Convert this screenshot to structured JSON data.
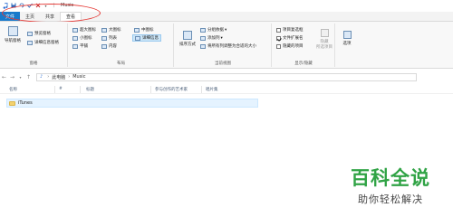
{
  "window": {
    "title": "Music"
  },
  "tabs": [
    {
      "label": "文件"
    },
    {
      "label": "主页"
    },
    {
      "label": "共享"
    },
    {
      "label": "查看"
    }
  ],
  "ribbon": {
    "panes": {
      "label": "窗格",
      "nav_pane": "导航窗格",
      "preview_pane": "预览窗格",
      "details_pane": "详细信息窗格"
    },
    "layout": {
      "label": "布局",
      "items": [
        "超大图标",
        "大图标",
        "中图标",
        "小图标",
        "列表",
        "详细信息",
        "平铺",
        "内容"
      ]
    },
    "current_view": {
      "label": "当前视图",
      "sort_by": "排序方式",
      "group_by": "分组依据",
      "add_columns": "添加列",
      "size_all_columns": "将所有列调整为合适的大小"
    },
    "show_hide": {
      "label": "显示/隐藏",
      "item_checkboxes": "项目复选框",
      "file_extensions": "文件扩展名",
      "hidden_items": "隐藏的项目",
      "hide_selected": "隐藏",
      "hide_selected_2": "所选项目"
    },
    "options": {
      "label": "选项"
    }
  },
  "address": {
    "crumbs": [
      "此电脑",
      "Music"
    ]
  },
  "columns": [
    "名称",
    "#",
    "标题",
    "参与创作的艺术家",
    "唱片集"
  ],
  "files": [
    {
      "name": "iTunes"
    }
  ],
  "watermark": {
    "main": "百科全说",
    "sub": "助你轻松解决"
  }
}
